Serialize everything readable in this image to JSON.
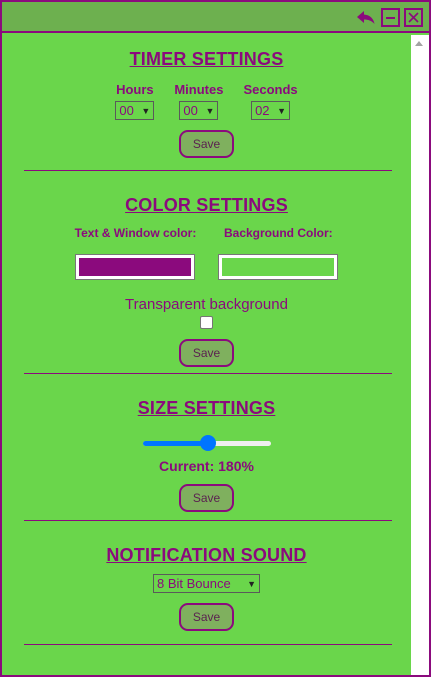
{
  "window": {
    "controls": [
      "back-icon",
      "minimize-icon",
      "close-icon"
    ]
  },
  "timer": {
    "title": "TIMER SETTINGS",
    "hours_label": "Hours",
    "minutes_label": "Minutes",
    "seconds_label": "Seconds",
    "hours_value": "00",
    "minutes_value": "00",
    "seconds_value": "02",
    "save_label": "Save"
  },
  "color": {
    "title": "COLOR SETTINGS",
    "text_label": "Text & Window color:",
    "bg_label": "Background Color:",
    "text_color": "#8b0a7d",
    "bg_color": "#6ad64b",
    "transparent_label": "Transparent background",
    "transparent_checked": false,
    "save_label": "Save"
  },
  "size": {
    "title": "SIZE SETTINGS",
    "slider_fraction": 0.51,
    "current_label": "Current: 180%",
    "save_label": "Save"
  },
  "sound": {
    "title": "NOTIFICATION SOUND",
    "selected": "8 Bit Bounce",
    "save_label": "Save"
  }
}
